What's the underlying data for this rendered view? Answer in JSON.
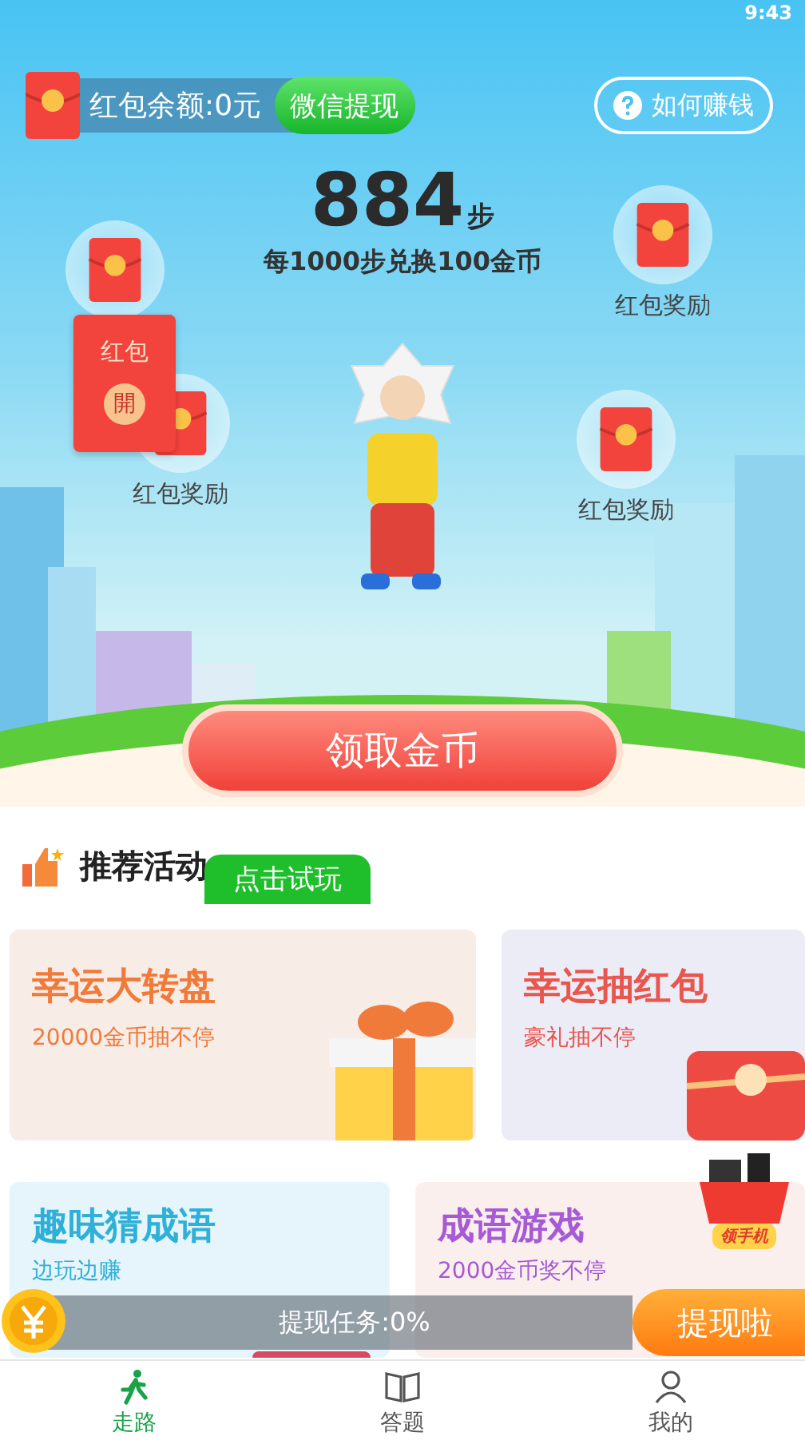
{
  "status_bar": {
    "time": "9:43"
  },
  "balance": {
    "label": "红包余额:0元",
    "button": "微信提现"
  },
  "help_button": "如何赚钱",
  "steps": {
    "count": "884",
    "unit": "步",
    "note": "每1000步兑换100金币"
  },
  "bubbles": [
    {
      "kind": "covered"
    },
    {
      "kind": "labeled",
      "label": "红包奖励"
    },
    {
      "kind": "labeled",
      "label": "红包奖励"
    },
    {
      "kind": "labeled",
      "label": "红包奖励"
    }
  ],
  "open_packet": {
    "title": "红包",
    "seal": "開"
  },
  "claim_button": "领取金币",
  "section_title": "推荐活动",
  "try_badge": "点击试玩",
  "activities": [
    {
      "title": "幸运大转盘",
      "subtitle": "20000金币抽不停",
      "color": "#f07a3a"
    },
    {
      "title": "幸运抽红包",
      "subtitle": "豪礼抽不停",
      "color": "#e8564e"
    },
    {
      "title": "趣味猜成语",
      "subtitle": "边玩边赚",
      "color": "#2fb0d8"
    },
    {
      "title": "成语游戏",
      "subtitle": "2000金币奖不停",
      "color": "#a65ad6"
    }
  ],
  "phone_promo": "领手机",
  "task_bar": {
    "label": "提现任务:0%",
    "button": "提现啦"
  },
  "tabs": [
    {
      "label": "走路",
      "selected": true
    },
    {
      "label": "答题",
      "selected": false
    },
    {
      "label": "我的",
      "selected": false
    }
  ]
}
